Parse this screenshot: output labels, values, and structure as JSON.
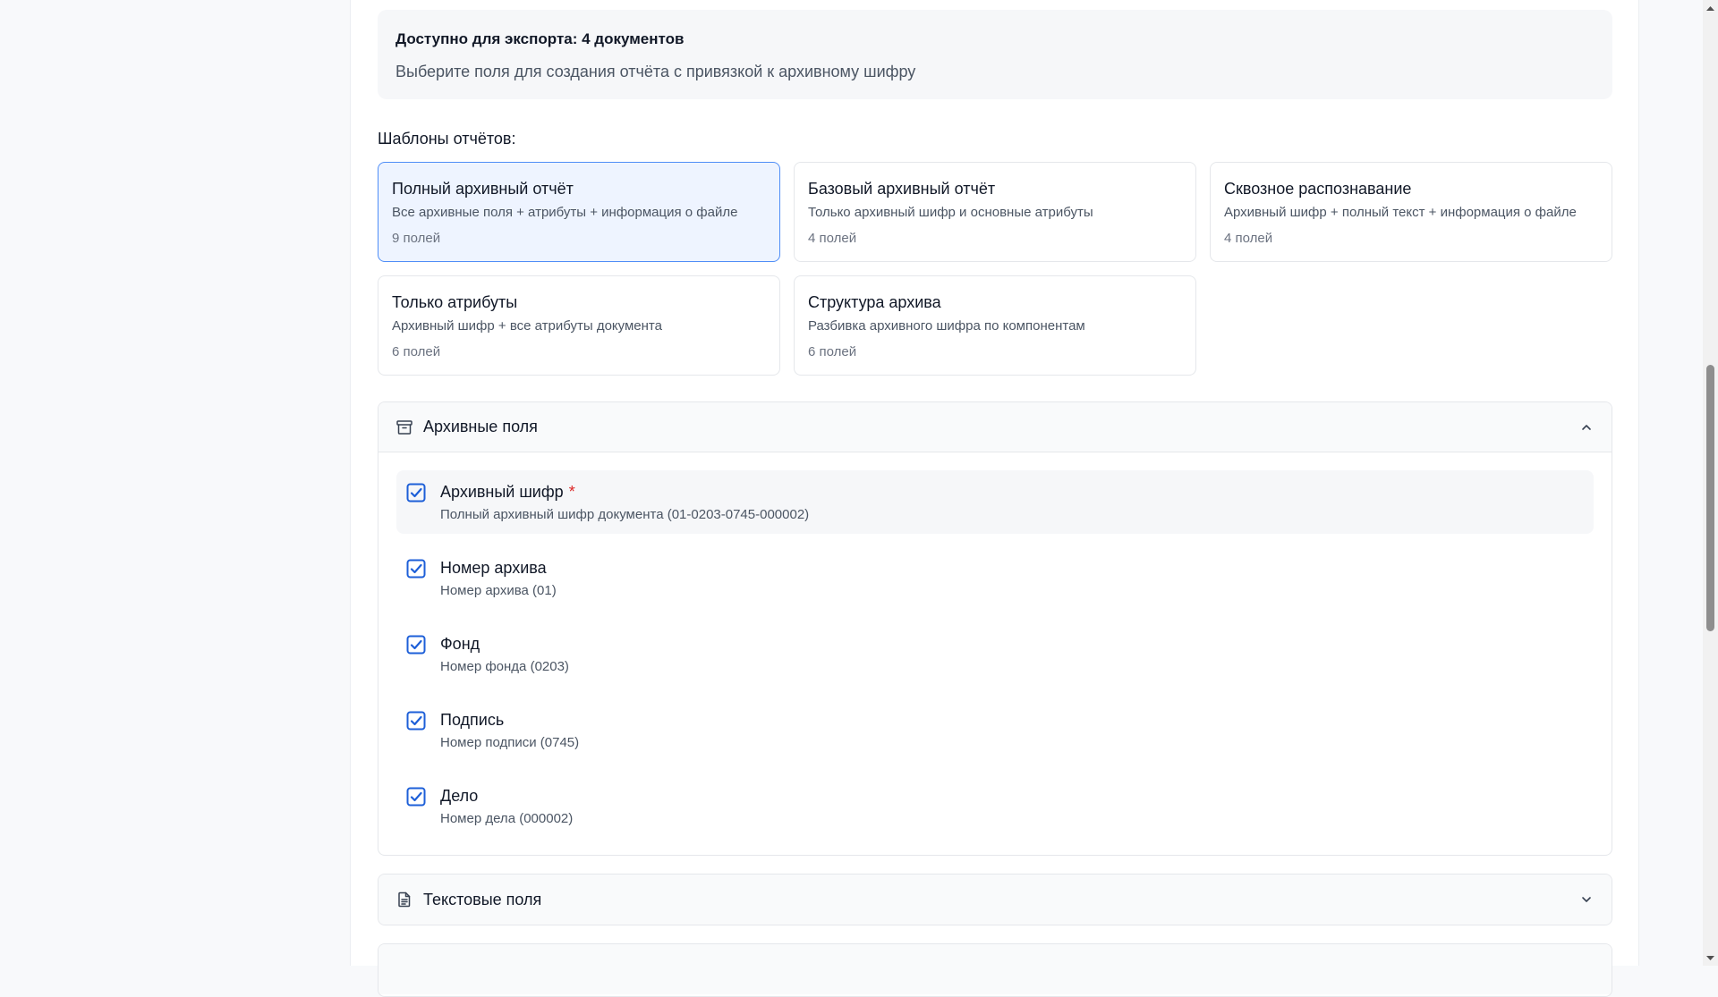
{
  "info": {
    "title": "Доступно для экспорта: 4 документов",
    "subtitle": "Выберите поля для создания отчёта с привязкой к архивному шифру"
  },
  "templates_label": "Шаблоны отчётов:",
  "templates": [
    {
      "name": "Полный архивный отчёт",
      "desc": "Все архивные поля + атрибуты + информация о файле",
      "count": "9 полей",
      "selected": true
    },
    {
      "name": "Базовый архивный отчёт",
      "desc": "Только архивный шифр и основные атрибуты",
      "count": "4 полей",
      "selected": false
    },
    {
      "name": "Сквозное распознавание",
      "desc": "Архивный шифр + полный текст + информация о файле",
      "count": "4 полей",
      "selected": false
    },
    {
      "name": "Только атрибуты",
      "desc": "Архивный шифр + все атрибуты документа",
      "count": "6 полей",
      "selected": false
    },
    {
      "name": "Структура архива",
      "desc": "Разбивка архивного шифра по компонентам",
      "count": "6 полей",
      "selected": false
    }
  ],
  "sections": {
    "archive": {
      "title": "Архивные поля",
      "icon": "archive-box-icon",
      "expanded": true,
      "fields": [
        {
          "name": "Архивный шифр",
          "required_mark": "*",
          "desc": "Полный архивный шифр документа (01-0203-0745-000002)",
          "checked": true
        },
        {
          "name": "Номер архива",
          "desc": "Номер архива (01)",
          "checked": true
        },
        {
          "name": "Фонд",
          "desc": "Номер фонда (0203)",
          "checked": true
        },
        {
          "name": "Подпись",
          "desc": "Номер подписи (0745)",
          "checked": true
        },
        {
          "name": "Дело",
          "desc": "Номер дела (000002)",
          "checked": true
        }
      ]
    },
    "text": {
      "title": "Текстовые поля",
      "icon": "document-text-icon",
      "expanded": false
    }
  },
  "colors": {
    "accent": "#1d5fd8",
    "selected_border": "#4f8ef7",
    "selected_bg": "#eef4ff",
    "required": "#dc2626"
  }
}
